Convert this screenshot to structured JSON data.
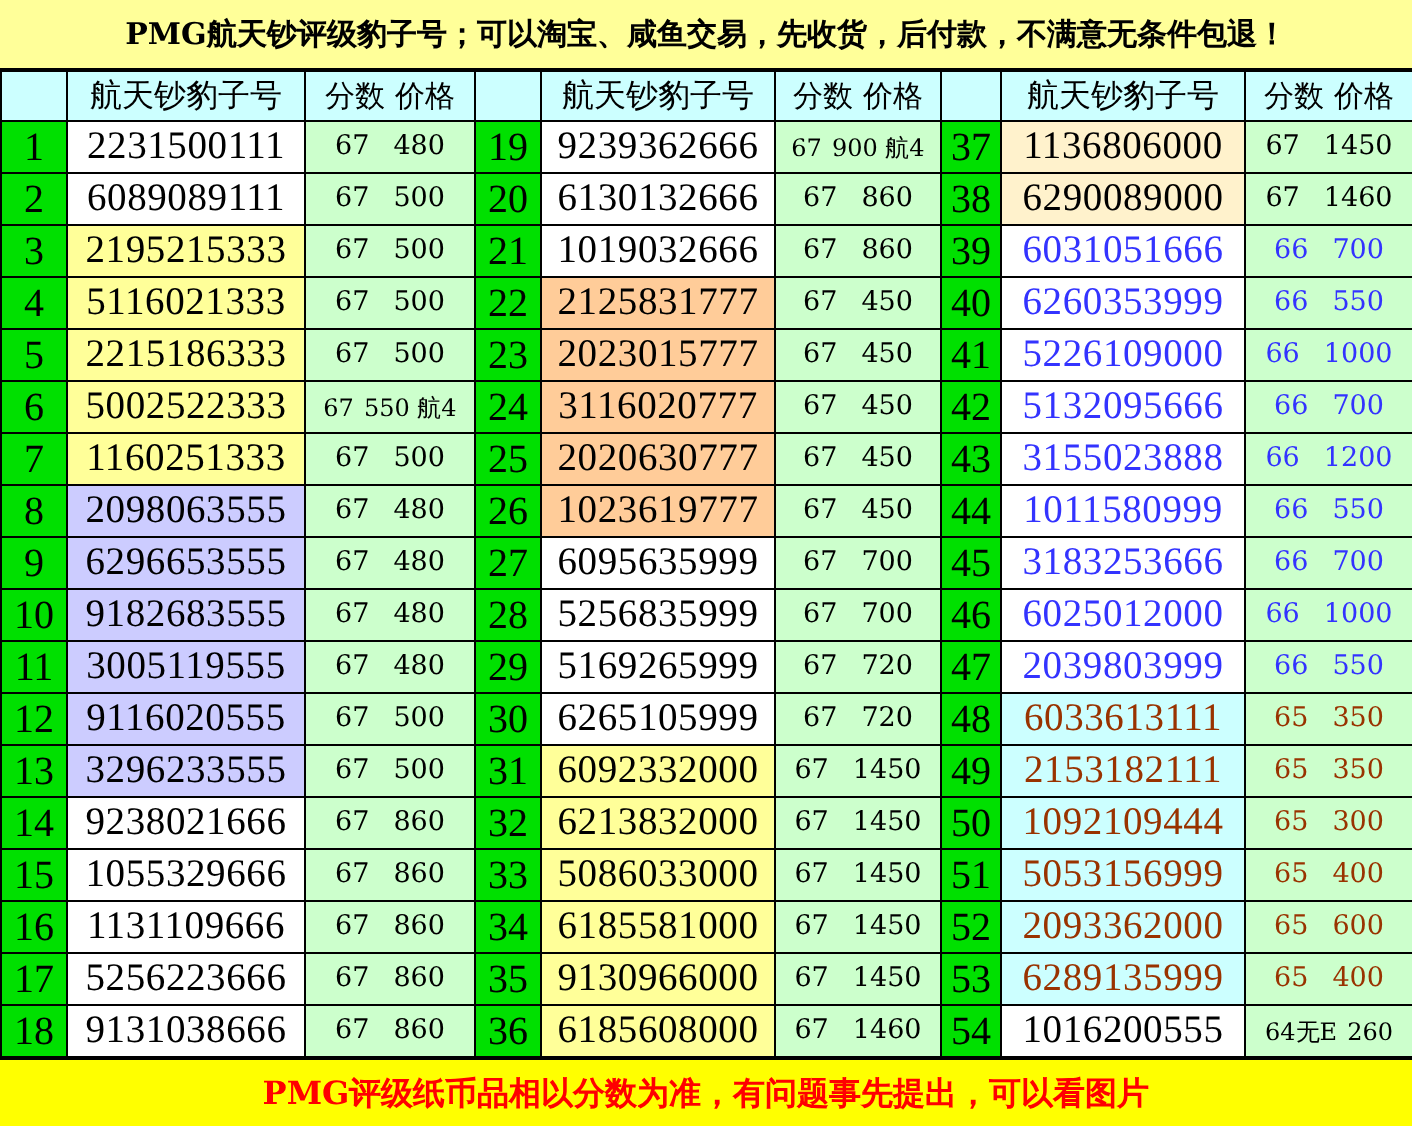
{
  "title": "PMG航天钞评级豹子号；可以淘宝、咸鱼交易，先收货，后付款，不满意无条件包退！",
  "table": {
    "header_groups": [
      {
        "serial": "航天钞豹子号",
        "grade_price": "分数 价格"
      },
      {
        "serial": "航天钞豹子号",
        "grade_price": "分数 价格"
      },
      {
        "serial": "航天钞豹子号",
        "grade_price": "分数 价格"
      }
    ],
    "rows": [
      {
        "index": "1",
        "serial": "2231500111",
        "score": "67",
        "price": "480",
        "color": "#ffffff",
        "kind": "standard"
      },
      {
        "index": "2",
        "serial": "6089089111",
        "score": "67",
        "price": "500",
        "color": "#ffffff",
        "kind": "standard"
      },
      {
        "index": "3",
        "serial": "2195215333",
        "score": "67",
        "price": "500",
        "color": "#ffff99",
        "kind": "standard"
      },
      {
        "index": "4",
        "serial": "5116021333",
        "score": "67",
        "price": "500",
        "color": "#ffff99",
        "kind": "standard"
      },
      {
        "index": "5",
        "serial": "2215186333",
        "score": "67",
        "price": "500",
        "color": "#ffff99",
        "kind": "standard"
      },
      {
        "index": "6",
        "serial": "5002522333",
        "score": "67",
        "price": "550 航4",
        "color": "#ffff99",
        "kind": "standard"
      },
      {
        "index": "7",
        "serial": "1160251333",
        "score": "67",
        "price": "500",
        "color": "#ffff99",
        "kind": "standard"
      },
      {
        "index": "8",
        "serial": "2098063555",
        "score": "67",
        "price": "480",
        "color": "#ccccff",
        "kind": "standard"
      },
      {
        "index": "9",
        "serial": "6296653555",
        "score": "67",
        "price": "480",
        "color": "#ccccff",
        "kind": "standard"
      },
      {
        "index": "10",
        "serial": "9182683555",
        "score": "67",
        "price": "480",
        "color": "#ccccff",
        "kind": "standard"
      },
      {
        "index": "11",
        "serial": "3005119555",
        "score": "67",
        "price": "480",
        "color": "#ccccff",
        "kind": "standard"
      },
      {
        "index": "12",
        "serial": "9116020555",
        "score": "67",
        "price": "500",
        "color": "#ccccff",
        "kind": "standard"
      },
      {
        "index": "13",
        "serial": "3296233555",
        "score": "67",
        "price": "500",
        "color": "#ccccff",
        "kind": "standard"
      },
      {
        "index": "14",
        "serial": "9238021666",
        "score": "67",
        "price": "860",
        "color": "#ffffff",
        "kind": "standard"
      },
      {
        "index": "15",
        "serial": "1055329666",
        "score": "67",
        "price": "860",
        "color": "#ffffff",
        "kind": "standard"
      },
      {
        "index": "16",
        "serial": "1131109666",
        "score": "67",
        "price": "860",
        "color": "#ffffff",
        "kind": "standard"
      },
      {
        "index": "17",
        "serial": "5256223666",
        "score": "67",
        "price": "860",
        "color": "#ffffff",
        "kind": "standard"
      },
      {
        "index": "18",
        "serial": "9131038666",
        "score": "67",
        "price": "860",
        "color": "#ffffff",
        "kind": "standard"
      },
      {
        "index": "19",
        "serial": "9239362666",
        "score": "67",
        "price": "900 航4",
        "color": "#ffffff",
        "kind": "standard"
      },
      {
        "index": "20",
        "serial": "6130132666",
        "score": "67",
        "price": "860",
        "color": "#ffffff",
        "kind": "standard"
      },
      {
        "index": "21",
        "serial": "1019032666",
        "score": "67",
        "price": "860",
        "color": "#ffffff",
        "kind": "standard"
      },
      {
        "index": "22",
        "serial": "2125831777",
        "score": "67",
        "price": "450",
        "color": "#ffcc99",
        "kind": "standard"
      },
      {
        "index": "23",
        "serial": "2023015777",
        "score": "67",
        "price": "450",
        "color": "#ffcc99",
        "kind": "standard"
      },
      {
        "index": "24",
        "serial": "3116020777",
        "score": "67",
        "price": "450",
        "color": "#ffcc99",
        "kind": "standard"
      },
      {
        "index": "25",
        "serial": "2020630777",
        "score": "67",
        "price": "450",
        "color": "#ffcc99",
        "kind": "standard"
      },
      {
        "index": "26",
        "serial": "1023619777",
        "score": "67",
        "price": "450",
        "color": "#ffcc99",
        "kind": "standard"
      },
      {
        "index": "27",
        "serial": "6095635999",
        "score": "67",
        "price": "700",
        "color": "#ffffff",
        "kind": "standard"
      },
      {
        "index": "28",
        "serial": "5256835999",
        "score": "67",
        "price": "700",
        "color": "#ffffff",
        "kind": "standard"
      },
      {
        "index": "29",
        "serial": "5169265999",
        "score": "67",
        "price": "720",
        "color": "#ffffff",
        "kind": "standard"
      },
      {
        "index": "30",
        "serial": "6265105999",
        "score": "67",
        "price": "720",
        "color": "#ffffff",
        "kind": "standard"
      },
      {
        "index": "31",
        "serial": "6092332000",
        "score": "67",
        "price": "1450",
        "color": "#ffff99",
        "kind": "standard"
      },
      {
        "index": "32",
        "serial": "6213832000",
        "score": "67",
        "price": "1450",
        "color": "#ffff99",
        "kind": "standard"
      },
      {
        "index": "33",
        "serial": "5086033000",
        "score": "67",
        "price": "1450",
        "color": "#ffff99",
        "kind": "standard"
      },
      {
        "index": "34",
        "serial": "6185581000",
        "score": "67",
        "price": "1450",
        "color": "#ffff99",
        "kind": "standard"
      },
      {
        "index": "35",
        "serial": "9130966000",
        "score": "67",
        "price": "1450",
        "color": "#ffff99",
        "kind": "standard"
      },
      {
        "index": "36",
        "serial": "6185608000",
        "score": "67",
        "price": "1460",
        "color": "#ffff99",
        "kind": "standard"
      },
      {
        "index": "37",
        "serial": "1136806000",
        "score": "67",
        "price": "1450",
        "color": "#fff2cc",
        "kind": "standard"
      },
      {
        "index": "38",
        "serial": "6290089000",
        "score": "67",
        "price": "1460",
        "color": "#fff2cc",
        "kind": "standard"
      },
      {
        "index": "39",
        "serial": "6031051666",
        "score": "66",
        "price": "700",
        "color": "#ffffff",
        "kind": "secondary"
      },
      {
        "index": "40",
        "serial": "6260353999",
        "score": "66",
        "price": "550",
        "color": "#ffffff",
        "kind": "secondary"
      },
      {
        "index": "41",
        "serial": "5226109000",
        "score": "66",
        "price": "1000",
        "color": "#ffffff",
        "kind": "secondary"
      },
      {
        "index": "42",
        "serial": "5132095666",
        "score": "66",
        "price": "700",
        "color": "#ffffff",
        "kind": "secondary"
      },
      {
        "index": "43",
        "serial": "3155023888",
        "score": "66",
        "price": "1200",
        "color": "#ffffff",
        "kind": "secondary"
      },
      {
        "index": "44",
        "serial": "1011580999",
        "score": "66",
        "price": "550",
        "color": "#ffffff",
        "kind": "secondary"
      },
      {
        "index": "45",
        "serial": "3183253666",
        "score": "66",
        "price": "700",
        "color": "#ffffff",
        "kind": "secondary"
      },
      {
        "index": "46",
        "serial": "6025012000",
        "score": "66",
        "price": "1000",
        "color": "#ffffff",
        "kind": "secondary"
      },
      {
        "index": "47",
        "serial": "2039803999",
        "score": "66",
        "price": "550",
        "color": "#ffffff",
        "kind": "secondary"
      },
      {
        "index": "48",
        "serial": "6033613111",
        "score": "65",
        "price": "350",
        "color": "#ccffff",
        "kind": "tertiary"
      },
      {
        "index": "49",
        "serial": "2153182111",
        "score": "65",
        "price": "350",
        "color": "#ccffff",
        "kind": "tertiary"
      },
      {
        "index": "50",
        "serial": "1092109444",
        "score": "65",
        "price": "300",
        "color": "#ccffff",
        "kind": "tertiary"
      },
      {
        "index": "51",
        "serial": "5053156999",
        "score": "65",
        "price": "400",
        "color": "#ccffff",
        "kind": "tertiary"
      },
      {
        "index": "52",
        "serial": "2093362000",
        "score": "65",
        "price": "600",
        "color": "#ccffff",
        "kind": "tertiary"
      },
      {
        "index": "53",
        "serial": "6289135999",
        "score": "65",
        "price": "400",
        "color": "#ccffff",
        "kind": "tertiary"
      },
      {
        "index": "54",
        "serial": "1016200555",
        "score": "64无E",
        "price": "260",
        "color": "#ffffff",
        "kind": "standard"
      }
    ]
  },
  "footer": "PMG评级纸币品相以分数为准，有问题事先提出，可以看图片"
}
